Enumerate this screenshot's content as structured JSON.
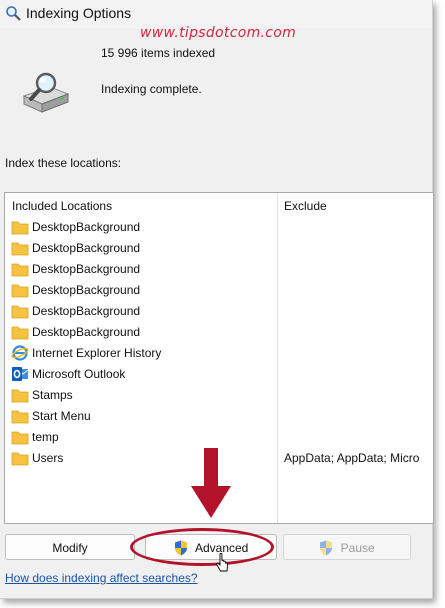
{
  "window": {
    "title": "Indexing Options"
  },
  "watermark": "www.tipsdotcom.com",
  "status": {
    "items_indexed": "15 996 items indexed",
    "state": "Indexing complete."
  },
  "locations_label": "Index these locations:",
  "table": {
    "headers": [
      "Included Locations",
      "Exclude"
    ],
    "rows": [
      {
        "name": "DesktopBackground",
        "exclude": "",
        "icon": "folder-icon"
      },
      {
        "name": "DesktopBackground",
        "exclude": "",
        "icon": "folder-icon"
      },
      {
        "name": "DesktopBackground",
        "exclude": "",
        "icon": "folder-icon"
      },
      {
        "name": "DesktopBackground",
        "exclude": "",
        "icon": "folder-icon"
      },
      {
        "name": "DesktopBackground",
        "exclude": "",
        "icon": "folder-icon"
      },
      {
        "name": "DesktopBackground",
        "exclude": "",
        "icon": "folder-icon"
      },
      {
        "name": "Internet Explorer History",
        "exclude": "",
        "icon": "internet-explorer-icon"
      },
      {
        "name": "Microsoft Outlook",
        "exclude": "",
        "icon": "outlook-icon"
      },
      {
        "name": "Stamps",
        "exclude": "",
        "icon": "folder-icon"
      },
      {
        "name": "Start Menu",
        "exclude": "",
        "icon": "folder-icon"
      },
      {
        "name": "temp",
        "exclude": "",
        "icon": "folder-icon"
      },
      {
        "name": "Users",
        "exclude": "AppData; AppData; Micro",
        "icon": "folder-icon"
      }
    ]
  },
  "buttons": {
    "modify": "Modify",
    "advanced": "Advanced",
    "pause": "Pause"
  },
  "help_link": "How does indexing affect searches?",
  "colors": {
    "folder": "#f5c242",
    "annotation_red": "#b3132a",
    "link": "#1a54a8"
  }
}
